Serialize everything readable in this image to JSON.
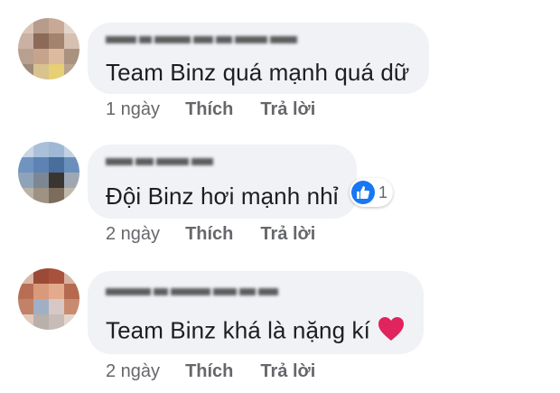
{
  "comments": [
    {
      "text": "Team Binz quá mạnh quá dữ",
      "time": "1 ngày",
      "like_label": "Thích",
      "reply_label": "Trả lời"
    },
    {
      "text": "Đội Binz hơi mạnh nhỉ",
      "time": "2 ngày",
      "like_label": "Thích",
      "reply_label": "Trả lời",
      "reaction_count": "1",
      "reaction_icon": "like-icon"
    },
    {
      "text": "Team Binz khá là nặng kí",
      "time": "2 ngày",
      "like_label": "Thích",
      "reply_label": "Trả lời",
      "emoji_icon": "red-heart-icon"
    }
  ],
  "colors": {
    "bubble_bg": "#f0f2f5",
    "text": "#1c1e21",
    "meta": "#65676b",
    "like_blue": "#1877f2",
    "heart_red": "#e0245e"
  }
}
